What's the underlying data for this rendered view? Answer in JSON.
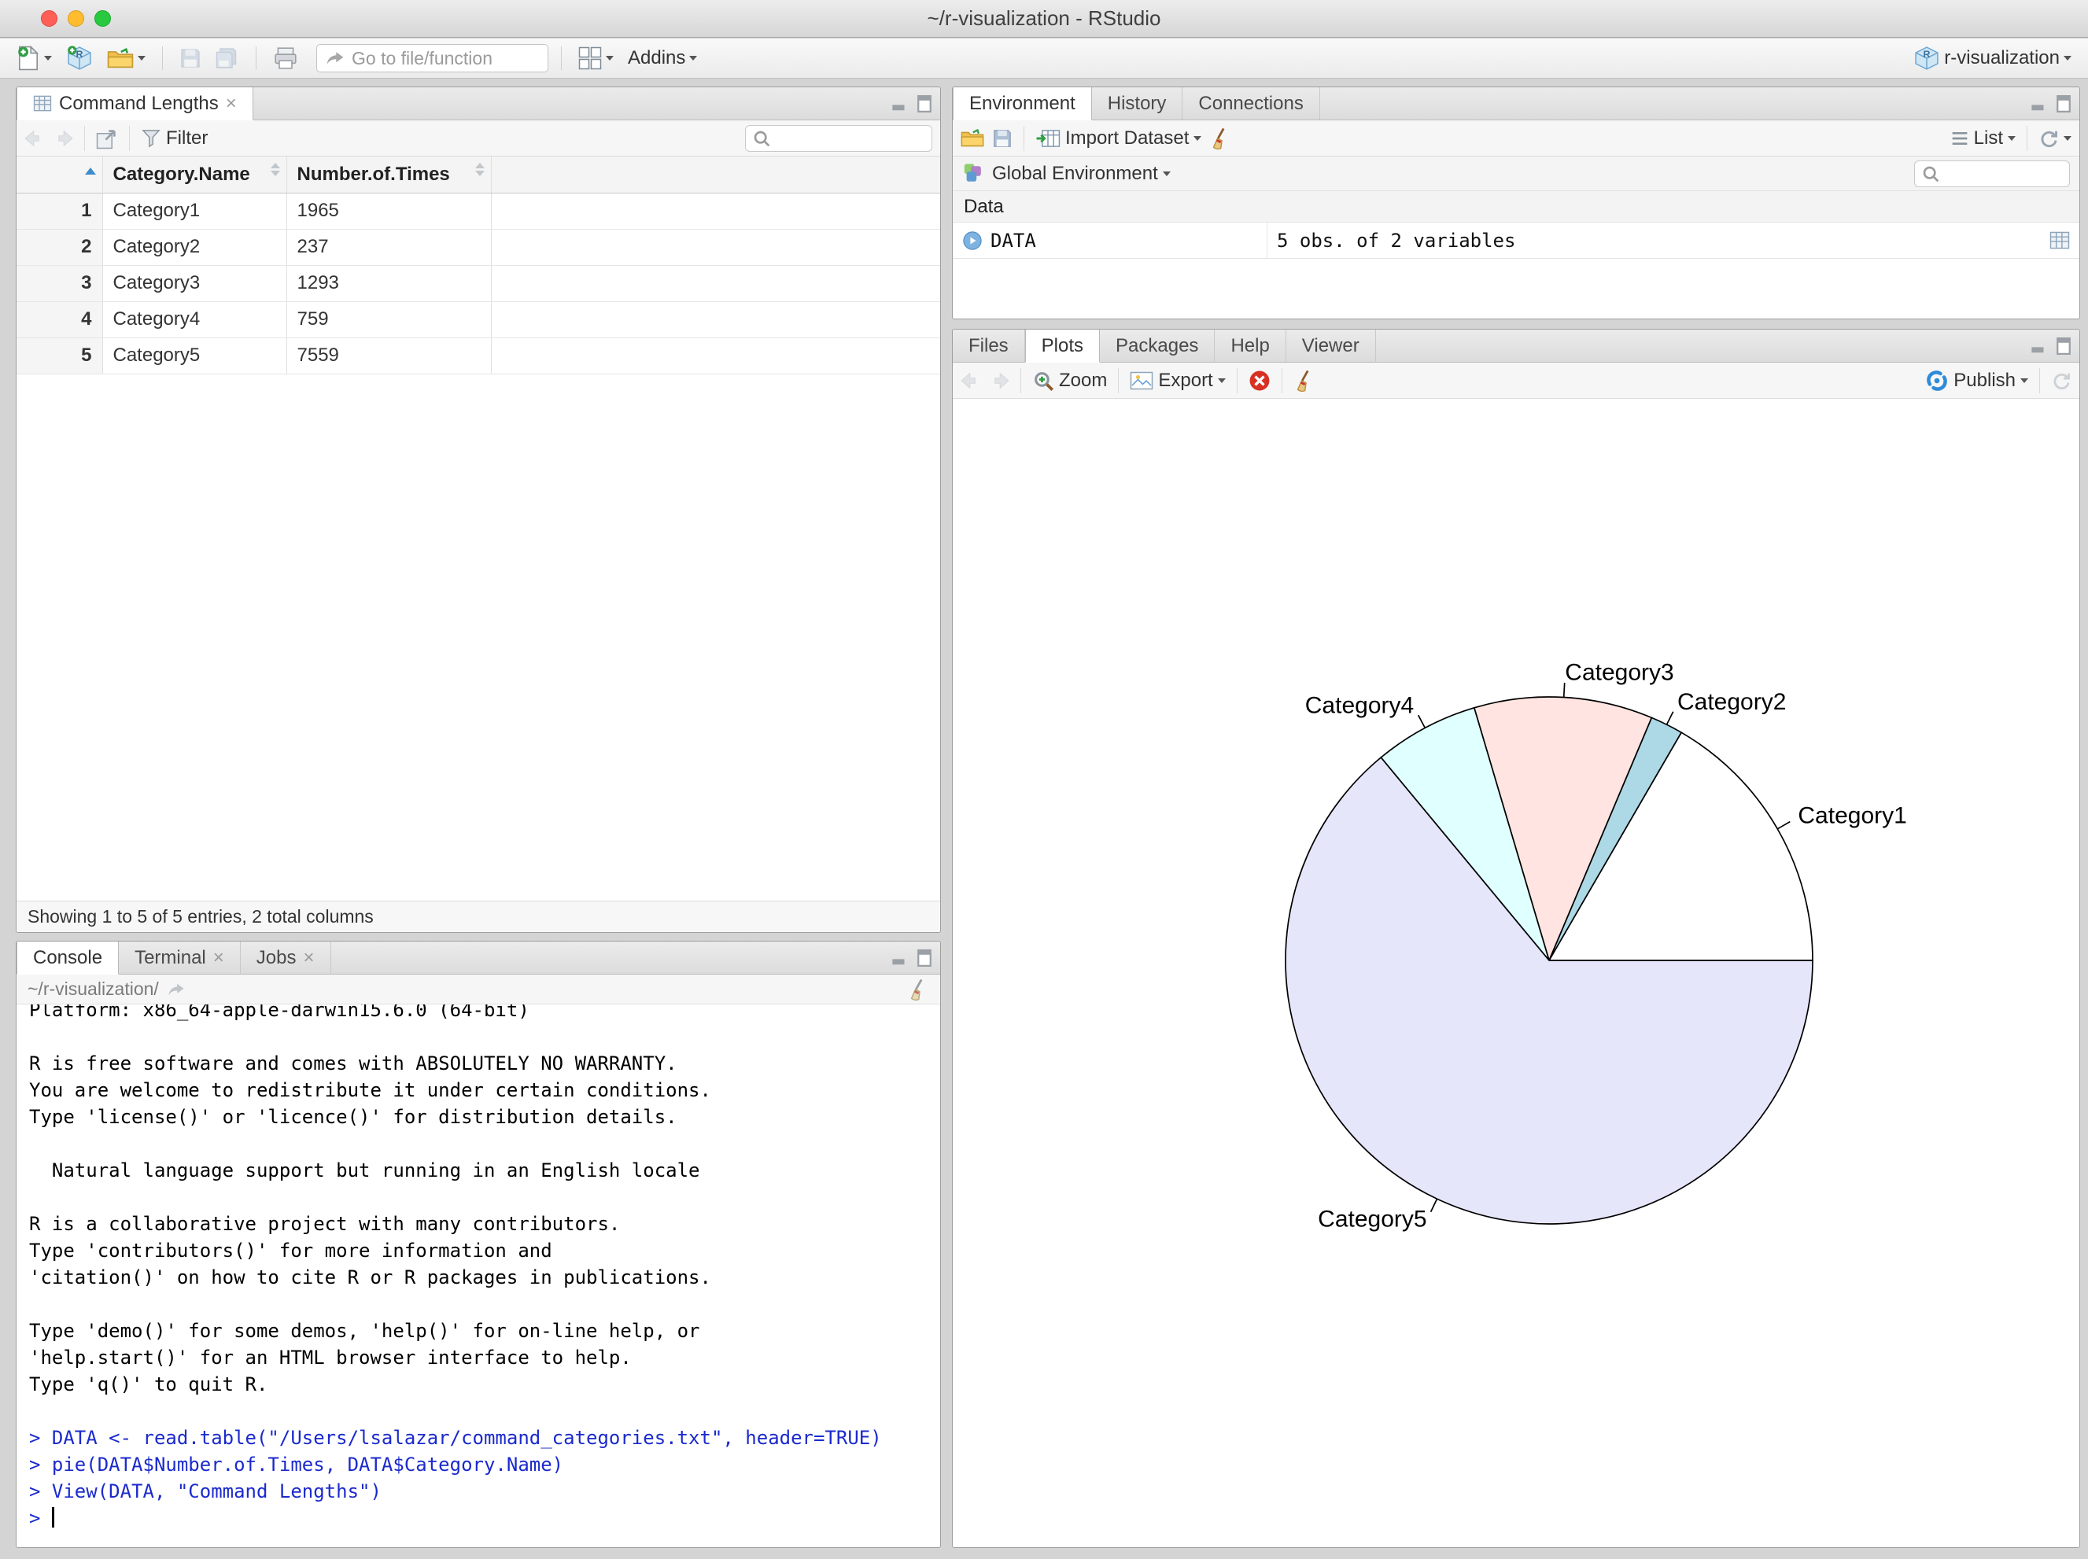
{
  "window": {
    "title": "~/r-visualization - RStudio"
  },
  "main_toolbar": {
    "goto_placeholder": "Go to file/function",
    "addins_label": "Addins",
    "project_label": "r-visualization"
  },
  "data_viewer": {
    "tab_label": "Command Lengths",
    "filter_label": "Filter",
    "table": {
      "columns": [
        "Category.Name",
        "Number.of.Times"
      ],
      "rows": [
        [
          "1",
          "Category1",
          "1965"
        ],
        [
          "2",
          "Category2",
          "237"
        ],
        [
          "3",
          "Category3",
          "1293"
        ],
        [
          "4",
          "Category4",
          "759"
        ],
        [
          "5",
          "Category5",
          "7559"
        ]
      ]
    },
    "status": "Showing 1 to 5 of 5 entries, 2 total columns"
  },
  "environment": {
    "tabs": [
      "Environment",
      "History",
      "Connections"
    ],
    "import_label": "Import Dataset",
    "list_label": "List",
    "scope_label": "Global Environment",
    "section_label": "Data",
    "object_name": "DATA",
    "object_desc": "5 obs. of 2 variables"
  },
  "plots": {
    "tabs": [
      "Files",
      "Plots",
      "Packages",
      "Help",
      "Viewer"
    ],
    "zoom_label": "Zoom",
    "export_label": "Export",
    "publish_label": "Publish"
  },
  "console": {
    "tabs": [
      "Console",
      "Terminal",
      "Jobs"
    ],
    "path": "~/r-visualization/",
    "lines": [
      {
        "type": "output",
        "text": "Platform: x86_64-apple-darwin15.6.0 (64-bit)",
        "clipped": true
      },
      {
        "type": "output",
        "text": ""
      },
      {
        "type": "output",
        "text": "R is free software and comes with ABSOLUTELY NO WARRANTY."
      },
      {
        "type": "output",
        "text": "You are welcome to redistribute it under certain conditions."
      },
      {
        "type": "output",
        "text": "Type 'license()' or 'licence()' for distribution details."
      },
      {
        "type": "output",
        "text": ""
      },
      {
        "type": "output",
        "text": "  Natural language support but running in an English locale"
      },
      {
        "type": "output",
        "text": ""
      },
      {
        "type": "output",
        "text": "R is a collaborative project with many contributors."
      },
      {
        "type": "output",
        "text": "Type 'contributors()' for more information and"
      },
      {
        "type": "output",
        "text": "'citation()' on how to cite R or R packages in publications."
      },
      {
        "type": "output",
        "text": ""
      },
      {
        "type": "output",
        "text": "Type 'demo()' for some demos, 'help()' for on-line help, or"
      },
      {
        "type": "output",
        "text": "'help.start()' for an HTML browser interface to help."
      },
      {
        "type": "output",
        "text": "Type 'q()' to quit R."
      },
      {
        "type": "output",
        "text": ""
      },
      {
        "type": "input",
        "text": "> DATA <- read.table(\"/Users/lsalazar/command_categories.txt\", header=TRUE)"
      },
      {
        "type": "input",
        "text": "> pie(DATA$Number.of.Times, DATA$Category.Name)"
      },
      {
        "type": "input",
        "text": "> View(DATA, \"Command Lengths\")"
      },
      {
        "type": "prompt",
        "text": "> "
      }
    ]
  },
  "chart_data": {
    "type": "pie",
    "categories": [
      "Category1",
      "Category2",
      "Category3",
      "Category4",
      "Category5"
    ],
    "values": [
      1965,
      237,
      1293,
      759,
      7559
    ],
    "colors": [
      "#FFFFFF",
      "#ADD8E6",
      "#FFE4E1",
      "#E0FFFF",
      "#E6E6FA"
    ],
    "start_angle": 0,
    "direction": "counterclockwise",
    "legend": "none",
    "title": ""
  }
}
